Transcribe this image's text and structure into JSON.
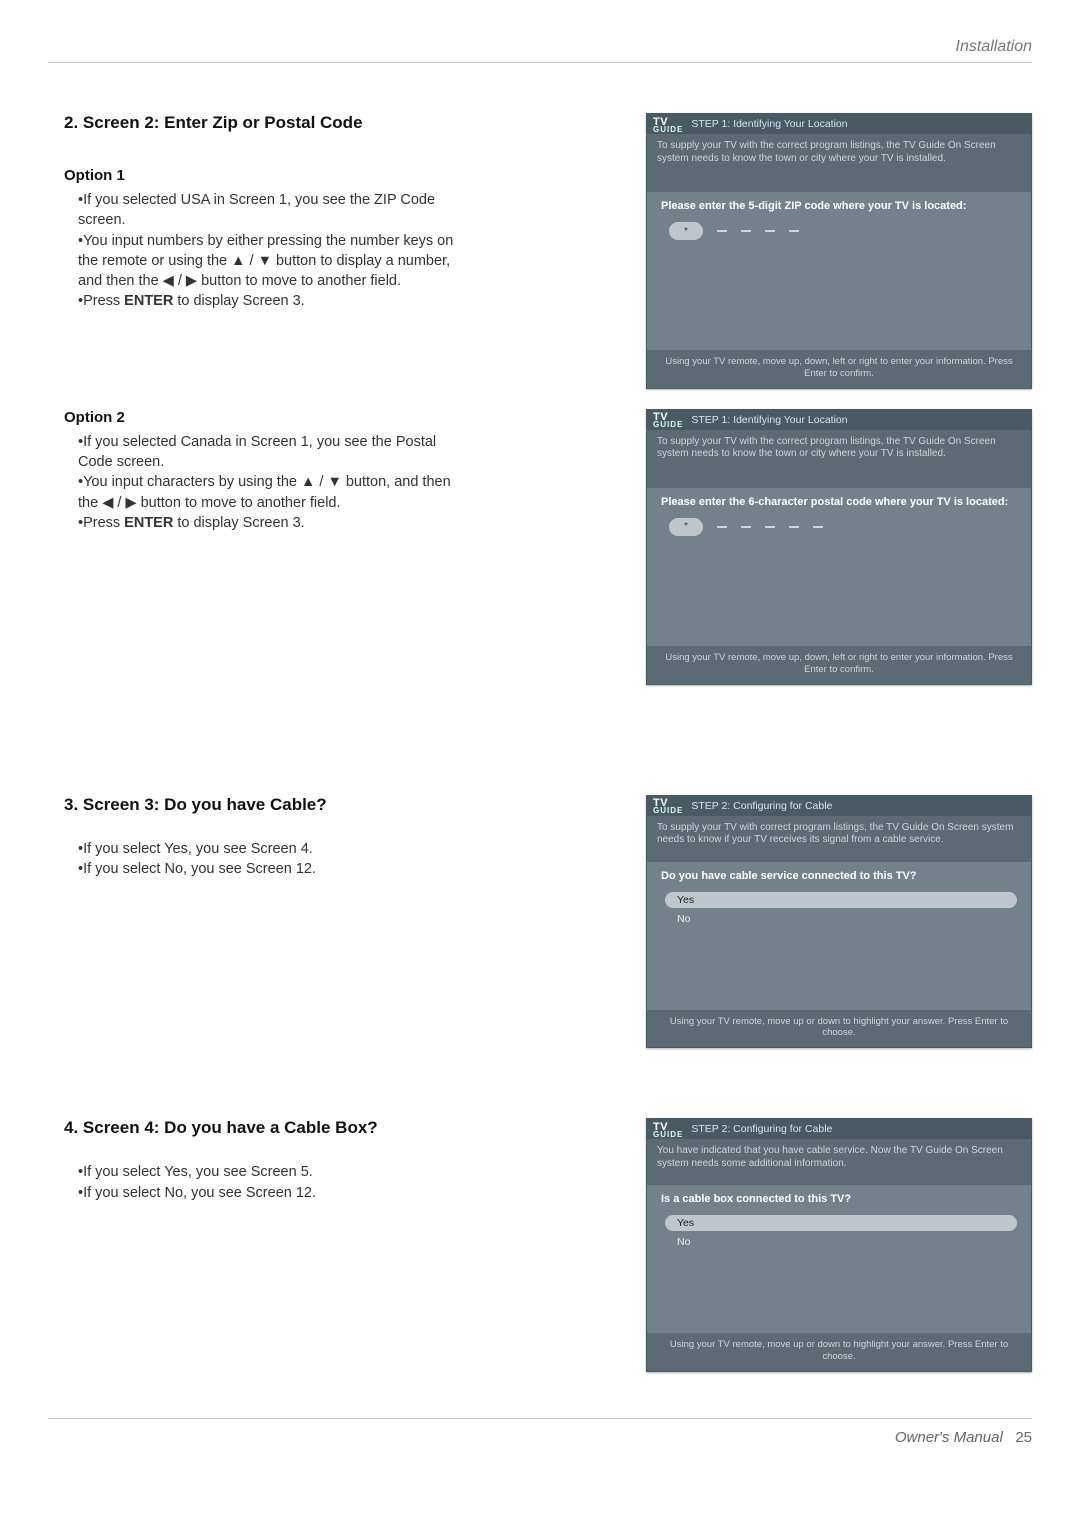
{
  "breadcrumb": "Installation",
  "section2": {
    "title": "2. Screen 2: Enter Zip or Postal Code",
    "option1": {
      "label": "Option 1",
      "b1": "•If you selected USA in Screen 1, you see the ZIP Code screen.",
      "b2a": "•You input numbers by either pressing the number keys on the remote or using the ",
      "a_up": "▲",
      "slash1": " / ",
      "a_down": "▼",
      "b2b": " button to display a number, and then the ",
      "a_left": "◀",
      "slash2": " / ",
      "a_right": "▶",
      "b2c": " button to move to another field.",
      "b3a": "•Press ",
      "enter": "ENTER",
      "b3b": " to display Screen 3."
    },
    "option2": {
      "label": "Option 2",
      "b1": "•If you selected Canada in Screen 1, you see the Postal Code screen.",
      "b2a": "•You input characters by using the ",
      "a_up": "▲",
      "slash1": " / ",
      "a_down": "▼",
      "b2b": " button, and then the ",
      "a_left": "◀",
      "slash2": " / ",
      "a_right": "▶",
      "b2c": " button to move to another field.",
      "b3a": "•Press ",
      "enter": "ENTER",
      "b3b": " to display Screen 3."
    }
  },
  "section3": {
    "title": "3. Screen 3: Do you have Cable?",
    "b1": "•If you select Yes, you see Screen 4.",
    "b2": "•If you select No, you see Screen 12."
  },
  "section4": {
    "title": "4. Screen 4: Do you have a Cable Box?",
    "b1": "•If you select Yes, you see Screen 5.",
    "b2": "•If you select No, you see Screen 12."
  },
  "osd_zip": {
    "step": "STEP 1: Identifying Your Location",
    "desc": "To supply your TV with the correct program listings, the TV Guide On Screen system needs to know the town or city where your TV is installed.",
    "prompt": "Please enter the 5-digit ZIP code where your TV is located:",
    "fields": 5,
    "foot": "Using your TV remote, move up, down, left or right to enter your information. Press Enter to confirm."
  },
  "osd_postal": {
    "step": "STEP 1: Identifying Your Location",
    "desc": "To supply your TV with the correct program listings, the TV Guide On Screen system needs to know the town or city where your TV is installed.",
    "prompt": "Please enter the 6-character postal code where your TV is located:",
    "fields": 6,
    "foot": "Using your TV remote, move up, down, left or right to enter your information. Press Enter to confirm."
  },
  "osd_cable": {
    "step": "STEP 2: Configuring for Cable",
    "desc": "To supply your TV with correct program listings, the TV Guide On Screen system needs to know if your TV receives its signal from a cable service.",
    "prompt": "Do you have cable service connected to this TV?",
    "yes": "Yes",
    "no": "No",
    "foot": "Using your TV remote, move up or down to highlight your answer. Press Enter to choose."
  },
  "osd_box": {
    "step": "STEP 2: Configuring for Cable",
    "desc": "You have indicated that you have cable service. Now the TV Guide On Screen system needs some additional information.",
    "prompt": "Is a cable box connected to this TV?",
    "yes": "Yes",
    "no": "No",
    "foot": "Using your TV remote, move up or down to highlight your answer. Press Enter to choose."
  },
  "logo": {
    "t": "TV",
    "b": "GUIDE"
  },
  "field_star": "*",
  "footer": {
    "label": "Owner's Manual",
    "page": "25"
  }
}
